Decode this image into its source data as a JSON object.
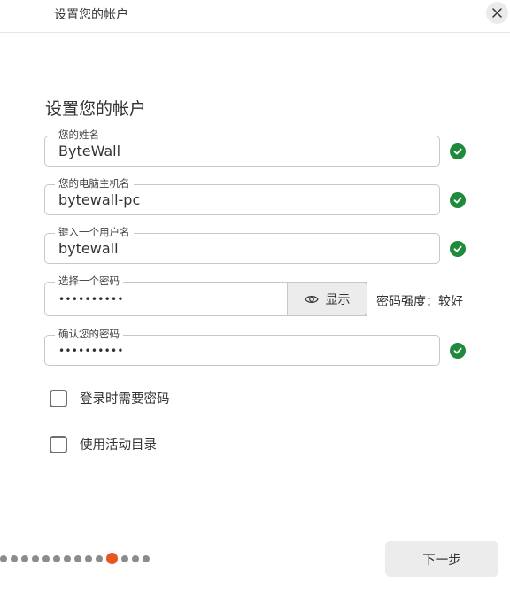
{
  "window": {
    "title": "设置您的帐户"
  },
  "page": {
    "heading": "设置您的帐户"
  },
  "fields": {
    "name": {
      "label": "您的姓名",
      "value": "ByteWall"
    },
    "computer": {
      "label": "您的电脑主机名",
      "value": "bytewall-pc"
    },
    "username": {
      "label": "键入一个用户名",
      "value": "bytewall"
    },
    "password": {
      "label": "选择一个密码",
      "value": "••••••••••"
    },
    "confirm": {
      "label": "确认您的密码",
      "value": "••••••••••"
    }
  },
  "show_button": {
    "label": "显示",
    "icon": "eye-icon"
  },
  "password_strength": "密码强度：较好",
  "options": {
    "require_password": {
      "label": "登录时需要密码",
      "checked": false
    },
    "active_directory": {
      "label": "使用活动目录",
      "checked": false
    }
  },
  "pager": {
    "total": 14,
    "current": 10
  },
  "next_button": {
    "label": "下一步"
  },
  "colors": {
    "accent": "#E95420",
    "valid": "#1F8A3C"
  }
}
